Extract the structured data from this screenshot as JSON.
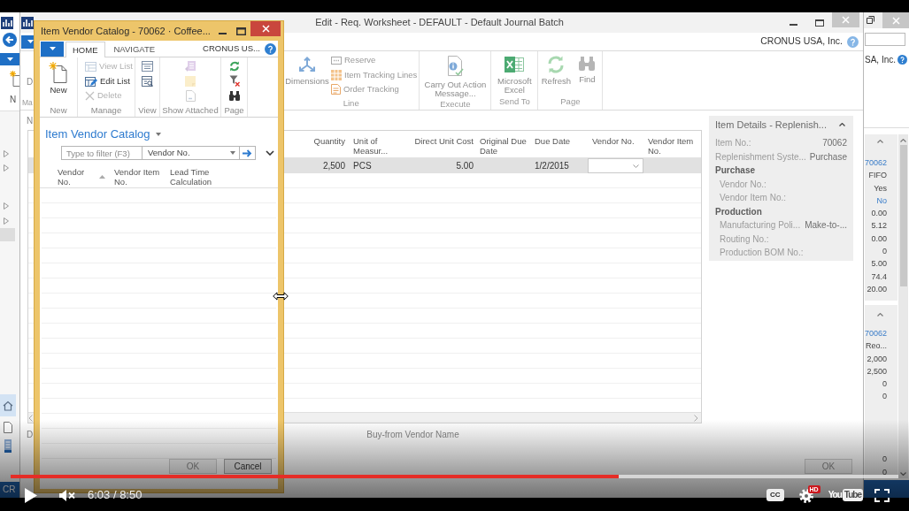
{
  "left_window": {
    "ribbon_label_cut": "N",
    "status_bar": "CR"
  },
  "main_window": {
    "title": "Edit - Req. Worksheet - DEFAULT - Default Journal Batch",
    "company": "CRONUS USA, Inc.",
    "ribbon": {
      "cut_button_label": "D",
      "cut_group_label": "Ma",
      "groups": [
        {
          "label": "Line",
          "buttons": [
            {
              "kind": "large",
              "label": "Dimensions"
            },
            {
              "kind": "small",
              "label": "Reserve"
            },
            {
              "kind": "small",
              "label": "Item Tracking Lines"
            },
            {
              "kind": "small",
              "label": "Order Tracking"
            }
          ]
        },
        {
          "label": "Execute",
          "buttons": [
            {
              "kind": "large",
              "label": "Carry Out Action Message..."
            }
          ]
        },
        {
          "label": "Send To",
          "buttons": [
            {
              "kind": "large",
              "label": "Microsoft Excel"
            }
          ]
        },
        {
          "label": "Page",
          "buttons": [
            {
              "kind": "large",
              "label": "Refresh"
            },
            {
              "kind": "large",
              "label": "Find"
            }
          ]
        }
      ]
    },
    "cut_heading": "N",
    "table": {
      "columns": [
        "Quantity",
        "Unit of Measur...",
        "Direct Unit Cost",
        "Original Due Date",
        "Due Date",
        "Vendor No.",
        "Vendor Item No."
      ],
      "rows": [
        {
          "selected": true,
          "quantity": "2,500",
          "unit_of_measure": "PCS",
          "direct_unit_cost": "5.00",
          "due_date": "1/2/2015"
        }
      ]
    },
    "cut_field_label": "D",
    "field_label": "Buy-from Vendor Name",
    "factbox": {
      "title": "Item Details - Replenish...",
      "fields": [
        {
          "label": "Item No.:",
          "value": "70062"
        },
        {
          "label": "Replenishment Syste...",
          "value": "Purchase"
        }
      ],
      "sections": [
        {
          "heading": "Purchase",
          "fields": [
            {
              "label": "Vendor No.:"
            },
            {
              "label": "Vendor Item No.:"
            }
          ]
        },
        {
          "heading": "Production",
          "fields": [
            {
              "label": "Manufacturing Poli...",
              "value": "Make-to-..."
            },
            {
              "label": "Routing No.:"
            },
            {
              "label": "Production BOM No.:"
            }
          ]
        }
      ]
    },
    "ok_button": "OK"
  },
  "catalog_window": {
    "title": "Item Vendor Catalog - 70062 · Coffee...",
    "tabs": [
      {
        "label": "HOME",
        "selected": true
      },
      {
        "label": "NAVIGATE",
        "selected": false
      }
    ],
    "company": "CRONUS US...",
    "ribbon": {
      "groups": [
        {
          "label": "New",
          "buttons": [
            {
              "kind": "large",
              "label": "New",
              "disabled": false
            }
          ]
        },
        {
          "label": "Manage",
          "buttons": [
            {
              "kind": "small",
              "label": "View List",
              "disabled": true
            },
            {
              "kind": "small",
              "label": "Edit List",
              "disabled": false
            },
            {
              "kind": "small",
              "label": "Delete",
              "disabled": true
            }
          ]
        },
        {
          "label": "View",
          "buttons": [
            {
              "kind": "icon",
              "disabled": false
            },
            {
              "kind": "icon",
              "disabled": false
            }
          ]
        },
        {
          "label": "Show Attached",
          "buttons": [
            {
              "kind": "icon",
              "disabled": true
            },
            {
              "kind": "icon",
              "disabled": true
            },
            {
              "kind": "icon",
              "disabled": true
            }
          ]
        },
        {
          "label": "Page",
          "buttons": [
            {
              "kind": "icon",
              "disabled": false
            },
            {
              "kind": "icon",
              "disabled": false
            },
            {
              "kind": "icon",
              "disabled": false
            }
          ]
        }
      ]
    },
    "page_title": "Item Vendor Catalog",
    "filter": {
      "placeholder": "Type to filter (F3)",
      "field": "Vendor No."
    },
    "columns": [
      {
        "label": "Vendor No.",
        "sorted": true
      },
      {
        "label": "Vendor Item No.",
        "sorted": false
      },
      {
        "label": "Lead Time Calculation",
        "sorted": false
      }
    ],
    "buttons": [
      {
        "label": "OK",
        "disabled": true
      },
      {
        "label": "Cancel",
        "disabled": false
      }
    ]
  },
  "right_window": {
    "company_cut": "SA, Inc.",
    "factboxes": [
      {
        "values": [
          {
            "text": "70062",
            "link": true
          },
          {
            "text": "FIFO",
            "link": false
          },
          {
            "text": "Yes",
            "link": false
          },
          {
            "text": "No",
            "link": true
          },
          {
            "text": "0.00",
            "link": false
          },
          {
            "text": "5.12",
            "link": false
          },
          {
            "text": "0.00",
            "link": false
          },
          {
            "text": "0",
            "link": false
          },
          {
            "text": "5.00",
            "link": false
          },
          {
            "text": "74.4",
            "link": false
          },
          {
            "text": "20.00",
            "link": false
          }
        ]
      },
      {
        "values": [
          {
            "text": "70062",
            "link": true
          },
          {
            "text": "Reo...",
            "link": false
          },
          {
            "text": "2,000",
            "link": false
          },
          {
            "text": "2,500",
            "link": false
          },
          {
            "text": "0",
            "link": false
          },
          {
            "text": "0",
            "link": false
          }
        ],
        "bottom_values": [
          {
            "text": "0",
            "link": false
          },
          {
            "text": "0",
            "link": false
          }
        ]
      }
    ]
  },
  "video_player": {
    "progress": {
      "level": 0.685
    },
    "time": "6:03 / 8:50",
    "captions_label": "CC",
    "quality_badge": "HD",
    "logo": {
      "first": "You",
      "second": "Tube"
    }
  }
}
